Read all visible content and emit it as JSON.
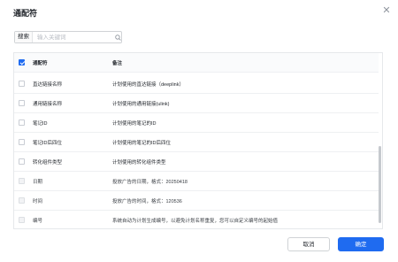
{
  "dialog": {
    "title": "通配符",
    "close_icon": "close-icon"
  },
  "search": {
    "category_label": "搜索",
    "placeholder": "输入关键词",
    "value": ""
  },
  "table": {
    "headers": {
      "name": "通配符",
      "desc": "备注"
    },
    "rows": [
      {
        "name": "直达链接名称",
        "desc": "计划使用的直达链接（deeplink）",
        "checked": false
      },
      {
        "name": "通用链接名称",
        "desc": "计划使用的通用链接(ulink)",
        "checked": false
      },
      {
        "name": "笔记ID",
        "desc": "计划使用的笔记的ID",
        "checked": false
      },
      {
        "name": "笔记ID后四位",
        "desc": "计划使用的笔记的ID后四位",
        "checked": false
      },
      {
        "name": "转化组件类型",
        "desc": "计划使用的转化组件类型",
        "checked": false
      },
      {
        "name": "日期",
        "desc": "投放广告的日期，格式：20250418",
        "checked": false
      },
      {
        "name": "时间",
        "desc": "投放广告的时间，格式：120536",
        "checked": false
      },
      {
        "name": "编号",
        "desc": "系统自动为计划生成编号，以避免计划名称重复，您可以自定义编号的起始值",
        "checked": false
      }
    ]
  },
  "footer": {
    "cancel_label": "取消",
    "ok_label": "确定"
  },
  "colors": {
    "primary": "#1f6bf0",
    "border": "#e6e8eb",
    "text": "#1f2329"
  }
}
